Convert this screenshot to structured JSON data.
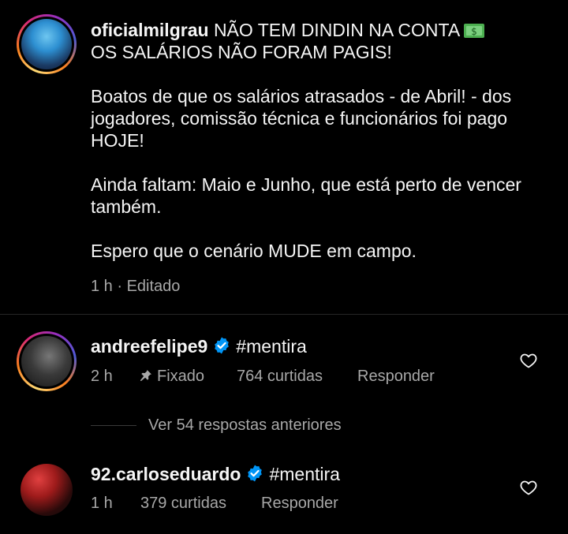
{
  "post": {
    "username": "oficialmilgrau",
    "caption_line1": "NÃO TEM DINDIN NA CONTA",
    "money_icon": "money-banknote-icon",
    "caption_rest": "OS SALÁRIOS NÃO FORAM PAGIS!\n\nBoatos de que os salários atrasados - de Abril! - dos jogadores, comissão técnica e funcionários foi pago HOJE!\n\nAinda faltam: Maio e Junho, que está perto de vencer também.\n\nEspero que o cenário MUDE em campo.",
    "meta": "1 h · Editado"
  },
  "comments": [
    {
      "username": "andreefelipe9",
      "verified": true,
      "text": "#mentira",
      "time": "2 h",
      "pinned_label": "Fixado",
      "likes": "764 curtidas",
      "reply": "Responder"
    },
    {
      "username": "92.carloseduardo",
      "verified": true,
      "text": "#mentira",
      "time": "1 h",
      "likes": "379 curtidas",
      "reply": "Responder"
    }
  ],
  "view_replies": "Ver 54 respostas anteriores",
  "colors": {
    "background": "#000000",
    "text": "#f5f5f5",
    "secondary": "#a8a8a8",
    "verified_blue": "#0095f6"
  }
}
